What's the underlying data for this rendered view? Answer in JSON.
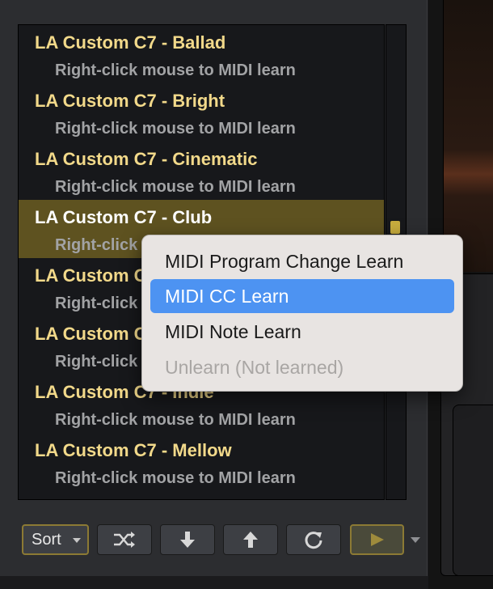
{
  "presets": [
    {
      "name": "LA Custom C7 - Ballad",
      "hint": "Right-click mouse to MIDI learn"
    },
    {
      "name": "LA Custom C7 - Bright",
      "hint": "Right-click mouse to MIDI learn"
    },
    {
      "name": "LA Custom C7 - Cinematic",
      "hint": "Right-click mouse to MIDI learn"
    },
    {
      "name": "LA Custom C7 - Club",
      "hint": "Right-click mouse to MIDI learn"
    },
    {
      "name": "LA Custom C7 - Funk",
      "hint": "Right-click mouse to MIDI learn"
    },
    {
      "name": "LA Custom C7 - Gentle",
      "hint": "Right-click mouse to MIDI learn"
    },
    {
      "name": "LA Custom C7 - Indie",
      "hint": "Right-click mouse to MIDI learn"
    },
    {
      "name": "LA Custom C7 - Mellow",
      "hint": "Right-click mouse to MIDI learn"
    }
  ],
  "context_menu": {
    "items": [
      {
        "label": "MIDI Program Change Learn",
        "state": "normal"
      },
      {
        "label": "MIDI CC Learn",
        "state": "highlighted"
      },
      {
        "label": "MIDI Note Learn",
        "state": "normal"
      },
      {
        "label": "Unlearn (Not learned)",
        "state": "disabled"
      }
    ]
  },
  "toolbar": {
    "sort_label": "Sort",
    "icons": [
      "shuffle-icon",
      "arrow-down-icon",
      "arrow-up-icon",
      "refresh-icon",
      "play-icon",
      "chevron-down-icon"
    ]
  },
  "colors": {
    "preset_name": "#f2d98a",
    "selected_row": "#5e5220",
    "menu_highlight": "#4d93f2",
    "accent_gold": "#8c7a34"
  }
}
